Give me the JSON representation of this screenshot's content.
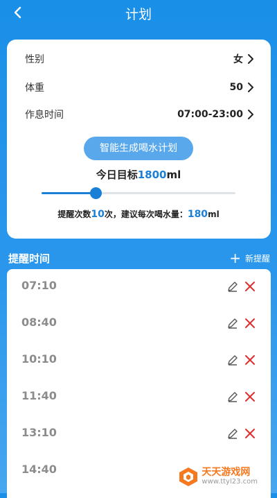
{
  "header": {
    "title": "计划",
    "back_icon": "chevron-left-icon"
  },
  "settings": [
    {
      "label": "性别",
      "value": "女"
    },
    {
      "label": "体重",
      "value": "50"
    },
    {
      "label": "作息时间",
      "value": "07:00-23:00"
    }
  ],
  "generate_button": "智能生成喝水计划",
  "goal": {
    "prefix": "今日目标",
    "amount": "1800",
    "unit": "ml"
  },
  "slider": {
    "fraction": 0.28
  },
  "reminder_info": {
    "count_prefix": "提醒次数",
    "count": "10",
    "count_suffix": "次，建议每次喝水量：",
    "amount": "180",
    "unit": "ml"
  },
  "section": {
    "title": "提醒时间",
    "add_label": "新提醒"
  },
  "reminders": [
    "07:10",
    "08:40",
    "10:10",
    "11:40",
    "13:10",
    "14:40"
  ],
  "watermark": {
    "name": "天天游戏网",
    "url": "www.ttyl23.com"
  },
  "colors": {
    "primary": "#1a8fe8",
    "accent": "#1a7fd6",
    "delete": "#e02d2d",
    "watermark": "#f47920"
  }
}
